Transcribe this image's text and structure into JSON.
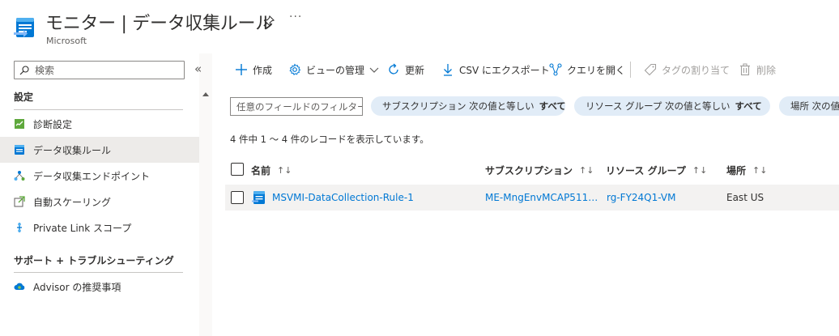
{
  "header": {
    "title": "モニター | データ収集ルール",
    "subtitle": "Microsoft",
    "more": "···"
  },
  "sidebar": {
    "search_placeholder": "検索",
    "collapse": "«",
    "sections": [
      {
        "heading": "設定",
        "items": [
          {
            "label": "診断設定",
            "icon": "diagnostic-settings-icon"
          },
          {
            "label": "データ収集ルール",
            "icon": "data-collection-rule-icon",
            "active": true
          },
          {
            "label": "データ収集エンドポイント",
            "icon": "data-collection-endpoint-icon"
          },
          {
            "label": "自動スケーリング",
            "icon": "autoscale-icon"
          },
          {
            "label": "Private Link スコープ",
            "icon": "private-link-icon"
          }
        ]
      },
      {
        "heading": "サポート + トラブルシューティング",
        "items": [
          {
            "label": "Advisor の推奨事項",
            "icon": "advisor-icon"
          }
        ]
      }
    ]
  },
  "toolbar": {
    "create": "作成",
    "manage_view": "ビューの管理",
    "refresh": "更新",
    "export_csv": "CSV にエクスポート",
    "open_query": "クエリを開く",
    "assign_tags": "タグの割り当て",
    "delete": "削除"
  },
  "filters": {
    "input_placeholder": "任意のフィールドのフィルター...",
    "pills": [
      {
        "label": "サブスクリプション 次の値と等しい",
        "value": "すべて",
        "removable": false
      },
      {
        "label": "リソース グループ 次の値と等しい",
        "value": "すべて",
        "removable": true
      },
      {
        "label": "場所 次の値",
        "value": "",
        "removable": false
      }
    ]
  },
  "record_count": "4 件中 1 ～ 4 件のレコードを表示しています。",
  "grid": {
    "columns": [
      "名前",
      "サブスクリプション",
      "リソース グループ",
      "場所"
    ],
    "sort_glyph": "↑↓",
    "rows": [
      {
        "name": "MSVMI-DataCollection-Rule-1",
        "subscription": "ME-MngEnvMCAP511…",
        "resource_group": "rg-FY24Q1-VM",
        "location": "East US"
      }
    ]
  },
  "colors": {
    "accent": "#0078d4",
    "active_nav": "#edebe9",
    "pill": "#e1ecf7",
    "row_hover": "#f3f2f1"
  }
}
